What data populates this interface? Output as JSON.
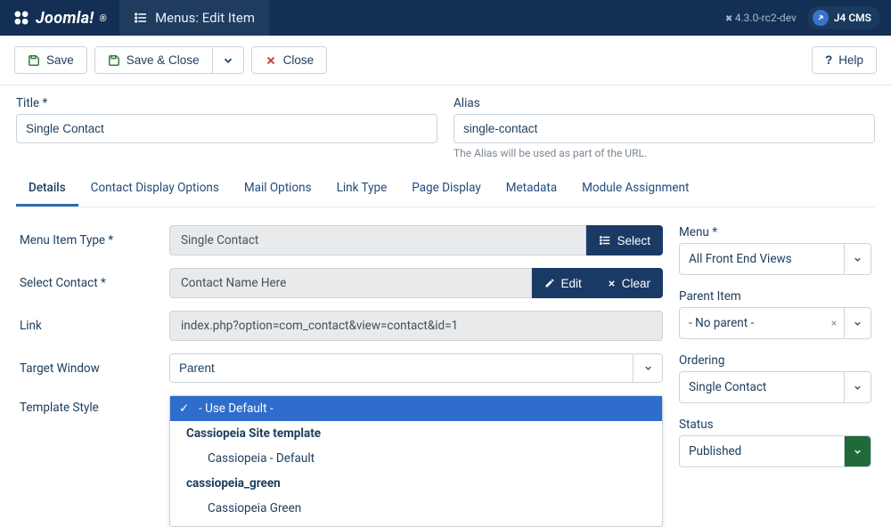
{
  "topbar": {
    "brand": "Joomla!",
    "page_title": "Menus: Edit Item",
    "version": "4.3.0-rc2-dev",
    "badge": "J4 CMS"
  },
  "toolbar": {
    "save": "Save",
    "save_close": "Save & Close",
    "close": "Close",
    "help": "Help"
  },
  "title_field": {
    "label": "Title",
    "value": "Single Contact"
  },
  "alias_field": {
    "label": "Alias",
    "value": "single-contact",
    "help": "The Alias will be used as part of the URL."
  },
  "tabs": [
    "Details",
    "Contact Display Options",
    "Mail Options",
    "Link Type",
    "Page Display",
    "Metadata",
    "Module Assignment"
  ],
  "details": {
    "menu_item_type": {
      "label": "Menu Item Type",
      "value": "Single Contact",
      "select_btn": "Select"
    },
    "select_contact": {
      "label": "Select Contact",
      "value": "Contact Name Here",
      "edit_btn": "Edit",
      "clear_btn": "Clear"
    },
    "link": {
      "label": "Link",
      "value": "index.php?option=com_contact&view=contact&id=1"
    },
    "target_window": {
      "label": "Target Window",
      "value": "Parent"
    },
    "template_style": {
      "label": "Template Style",
      "selected": "- Use Default -",
      "options": [
        {
          "label": "- Use Default -",
          "selected": true,
          "indent": 0
        },
        {
          "label": "Cassiopeia Site template",
          "group": true
        },
        {
          "label": "Cassiopeia - Default",
          "indent": 1
        },
        {
          "label": "cassiopeia_green",
          "group": true
        },
        {
          "label": "Cassiopeia Green",
          "indent": 1
        }
      ]
    }
  },
  "sidebar": {
    "menu": {
      "label": "Menu",
      "value": "All Front End Views"
    },
    "parent": {
      "label": "Parent Item",
      "value": "- No parent -"
    },
    "ordering": {
      "label": "Ordering",
      "value": "Single Contact"
    },
    "status": {
      "label": "Status",
      "value": "Published"
    }
  }
}
